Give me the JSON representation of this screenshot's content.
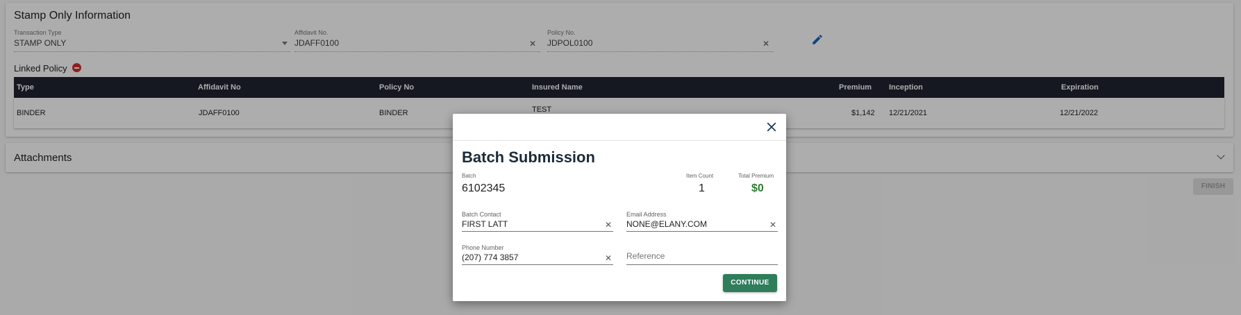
{
  "stamp": {
    "title": "Stamp Only Information",
    "transaction_type": {
      "label": "Transaction Type",
      "value": "STAMP ONLY"
    },
    "affidavit_no": {
      "label": "Affidavit No.",
      "value": "JDAFF0100"
    },
    "policy_no": {
      "label": "Policy No.",
      "value": "JDPOL0100"
    },
    "linked_policy_label": "Linked Policy",
    "table": {
      "headers": [
        "Type",
        "Affidavit No",
        "Policy No",
        "Insured Name",
        "Premium",
        "Inception",
        "Expiration"
      ],
      "rows": [
        [
          "BINDER",
          "JDAFF0100",
          "BINDER",
          "TEST",
          "$1,142",
          "12/21/2021",
          "12/21/2022"
        ]
      ]
    }
  },
  "attachments": {
    "title": "Attachments"
  },
  "finish_label": "FINISH",
  "modal": {
    "title": "Batch Submission",
    "batch_label": "Batch",
    "batch_value": "6102345",
    "item_count_label": "Item Count",
    "item_count_value": "1",
    "total_premium_label": "Total Premium",
    "total_premium_value": "$0",
    "batch_contact": {
      "label": "Batch Contact",
      "value": "FIRST LATT"
    },
    "email": {
      "label": "Email Address",
      "value": "NONE@ELANY.COM"
    },
    "phone": {
      "label": "Phone Number",
      "value": "(207) 774 3857"
    },
    "reference": {
      "placeholder": "Reference"
    },
    "continue_label": "CONTINUE"
  },
  "icons": {
    "close": "close-icon",
    "edit": "pencil-icon",
    "remove": "minus-circle-icon",
    "expand": "chevron-down-icon",
    "clear": "clear-x-icon"
  },
  "colors": {
    "table_header": "#1f2430",
    "accent_green": "#2e7d5b",
    "premium_green": "#2e7d32",
    "remove_red": "#d32f2f"
  }
}
